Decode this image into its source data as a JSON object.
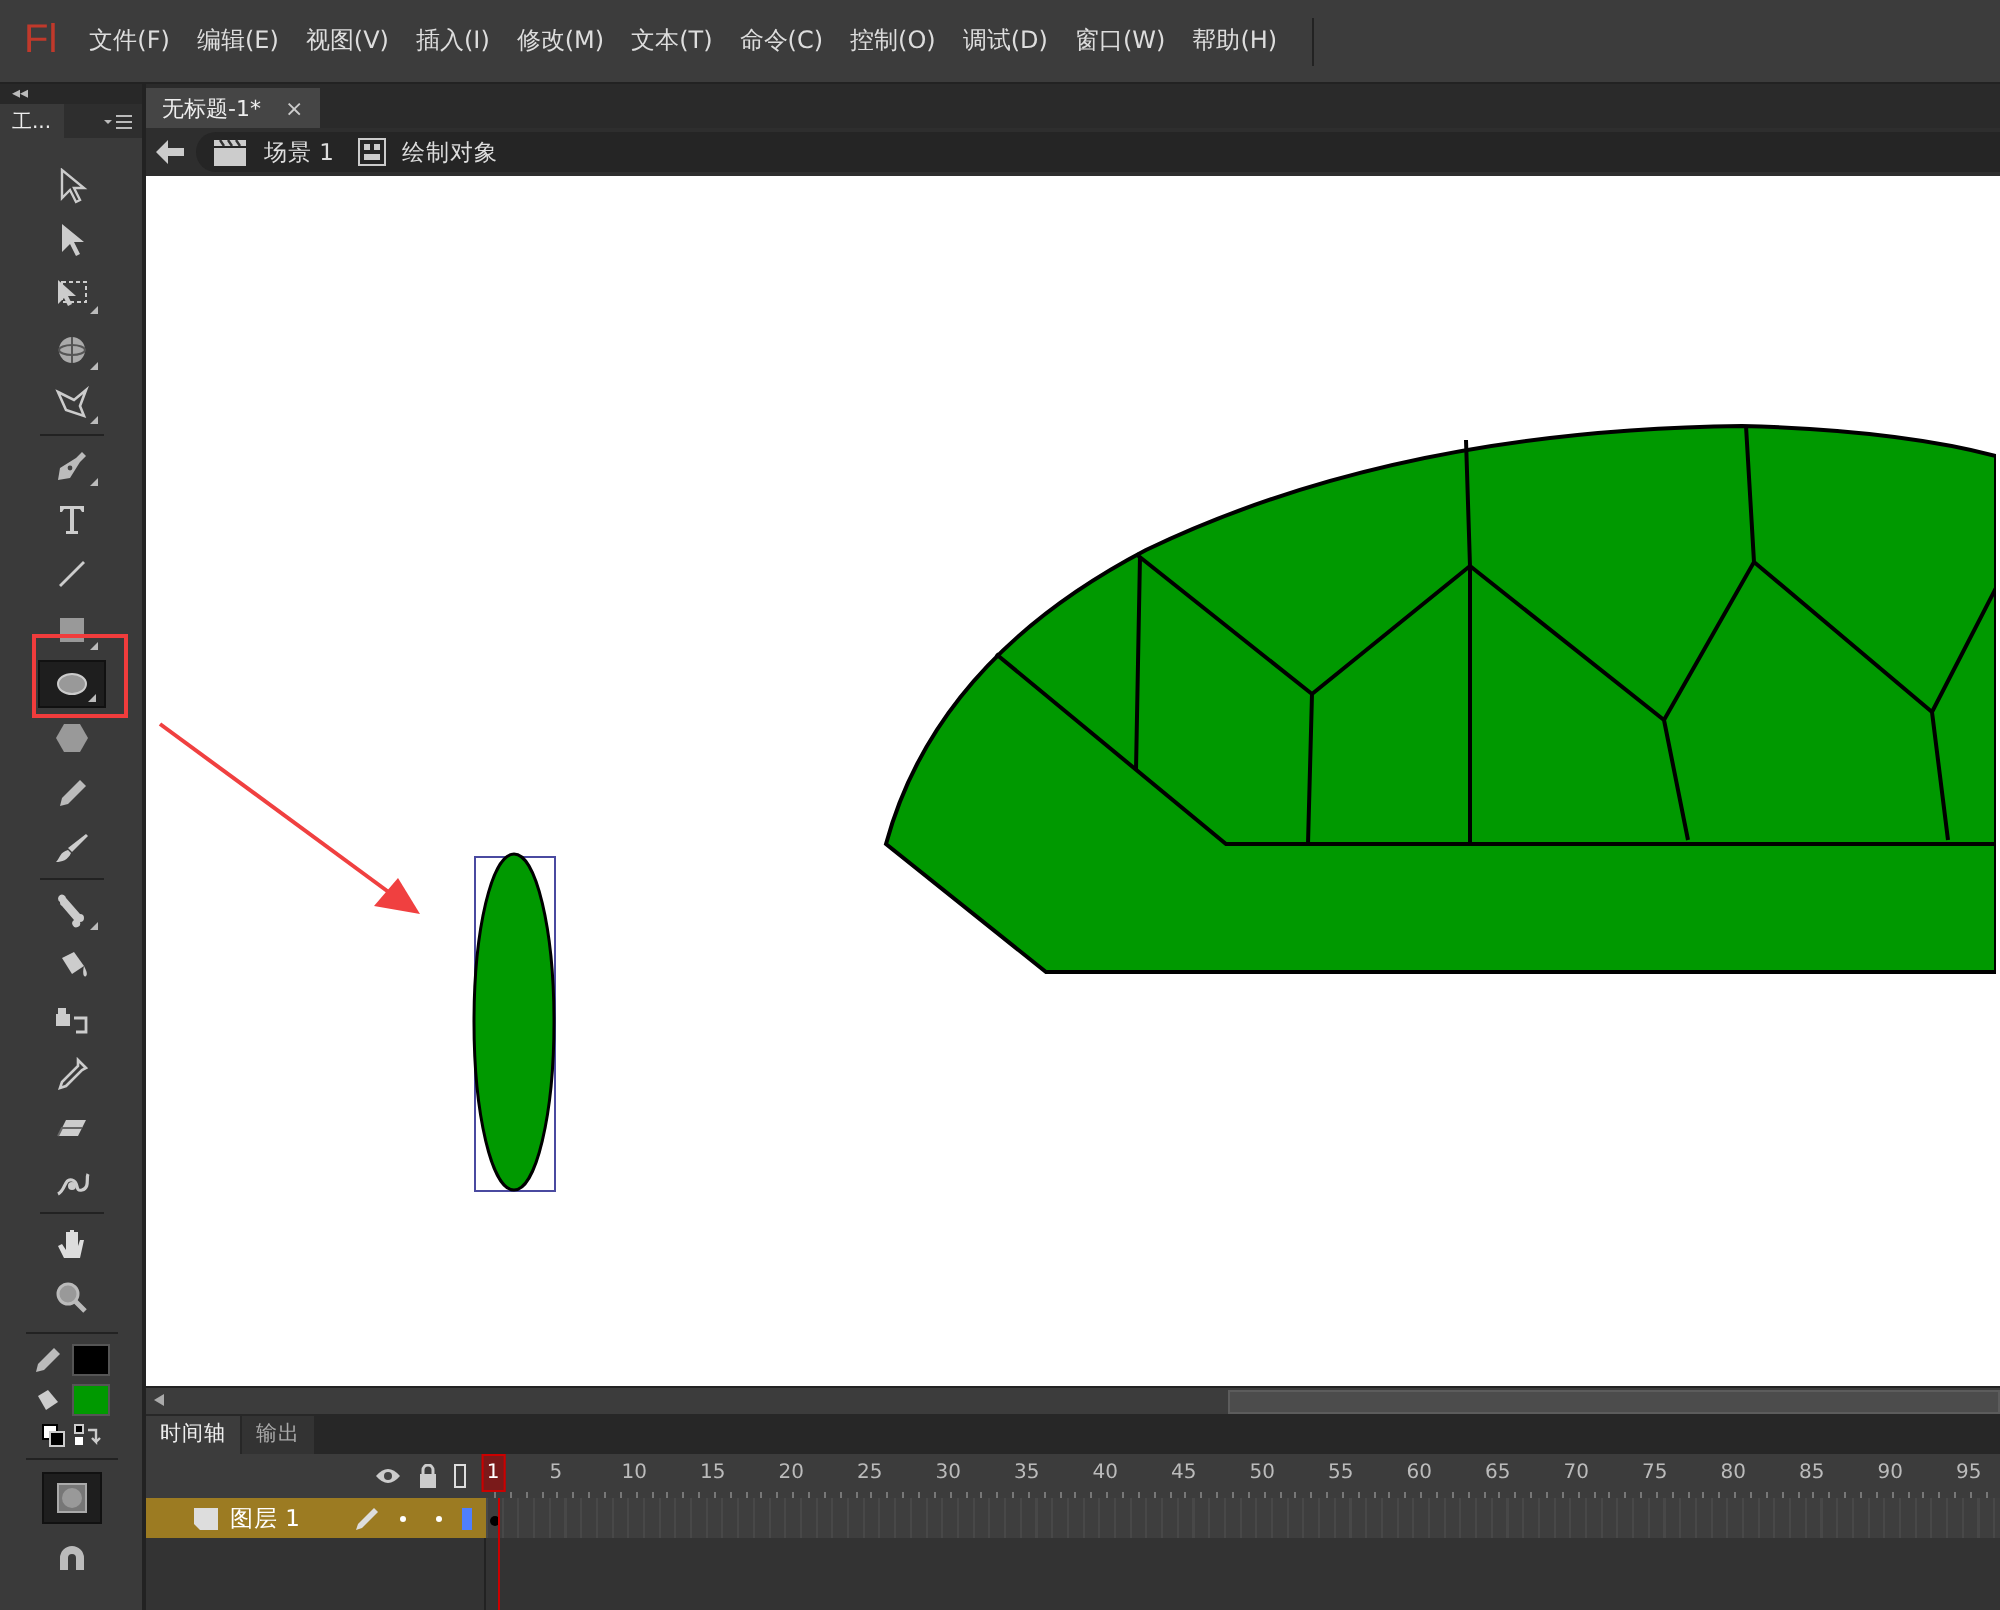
{
  "app": {
    "logo": "Fl"
  },
  "menu": [
    "文件(F)",
    "编辑(E)",
    "视图(V)",
    "插入(I)",
    "修改(M)",
    "文本(T)",
    "命令(C)",
    "控制(O)",
    "调试(D)",
    "窗口(W)",
    "帮助(H)"
  ],
  "toolbar": {
    "collapse": "◂◂",
    "tab": "工...",
    "tools": [
      {
        "kind": "selection",
        "selected": false,
        "submenu": false
      },
      {
        "kind": "subselection",
        "selected": false,
        "submenu": false
      },
      {
        "kind": "free-transform",
        "selected": false,
        "submenu": true
      },
      {
        "kind": "rotate-3d",
        "selected": false,
        "submenu": true
      },
      {
        "kind": "lasso",
        "selected": false,
        "submenu": true
      },
      {
        "kind": "separator"
      },
      {
        "kind": "pen",
        "selected": false,
        "submenu": true
      },
      {
        "kind": "text",
        "selected": false,
        "submenu": false
      },
      {
        "kind": "line",
        "selected": false,
        "submenu": false
      },
      {
        "kind": "rectangle",
        "selected": false,
        "submenu": true
      },
      {
        "kind": "oval",
        "selected": true,
        "submenu": true
      },
      {
        "kind": "polystar",
        "selected": false,
        "submenu": false
      },
      {
        "kind": "pencil",
        "selected": false,
        "submenu": false
      },
      {
        "kind": "brush",
        "selected": false,
        "submenu": false
      },
      {
        "kind": "separator"
      },
      {
        "kind": "bone",
        "selected": false,
        "submenu": true
      },
      {
        "kind": "paint-bucket",
        "selected": false,
        "submenu": false
      },
      {
        "kind": "ink-bottle",
        "selected": false,
        "submenu": false
      },
      {
        "kind": "eyedropper",
        "selected": false,
        "submenu": false
      },
      {
        "kind": "eraser",
        "selected": false,
        "submenu": false
      },
      {
        "kind": "deco",
        "selected": false,
        "submenu": false
      },
      {
        "kind": "separator"
      },
      {
        "kind": "hand",
        "selected": false,
        "submenu": false
      },
      {
        "kind": "zoom",
        "selected": false,
        "submenu": false
      }
    ],
    "swatches": [
      {
        "kind": "stroke",
        "color": "#000000"
      },
      {
        "kind": "fill",
        "color": "#009900"
      }
    ],
    "object_drawing": {
      "on": true
    }
  },
  "document_tabs": [
    {
      "label": "无标题-1*",
      "selected": true,
      "close": "×"
    }
  ],
  "breadcrumb": {
    "scene": "场景 1",
    "object": "绘制对象"
  },
  "panel_tabs": [
    {
      "label": "时间轴",
      "selected": true
    },
    {
      "label": "输出",
      "selected": false
    }
  ],
  "timeline": {
    "frame_numbers": [
      "1",
      "5",
      "10",
      "15",
      "20",
      "25",
      "30",
      "35",
      "40",
      "45",
      "50",
      "55",
      "60",
      "65",
      "70",
      "75",
      "80",
      "85",
      "90",
      "95"
    ],
    "layers": [
      {
        "name": "图层 1",
        "selected": true,
        "color": "#4f7fff"
      }
    ]
  }
}
